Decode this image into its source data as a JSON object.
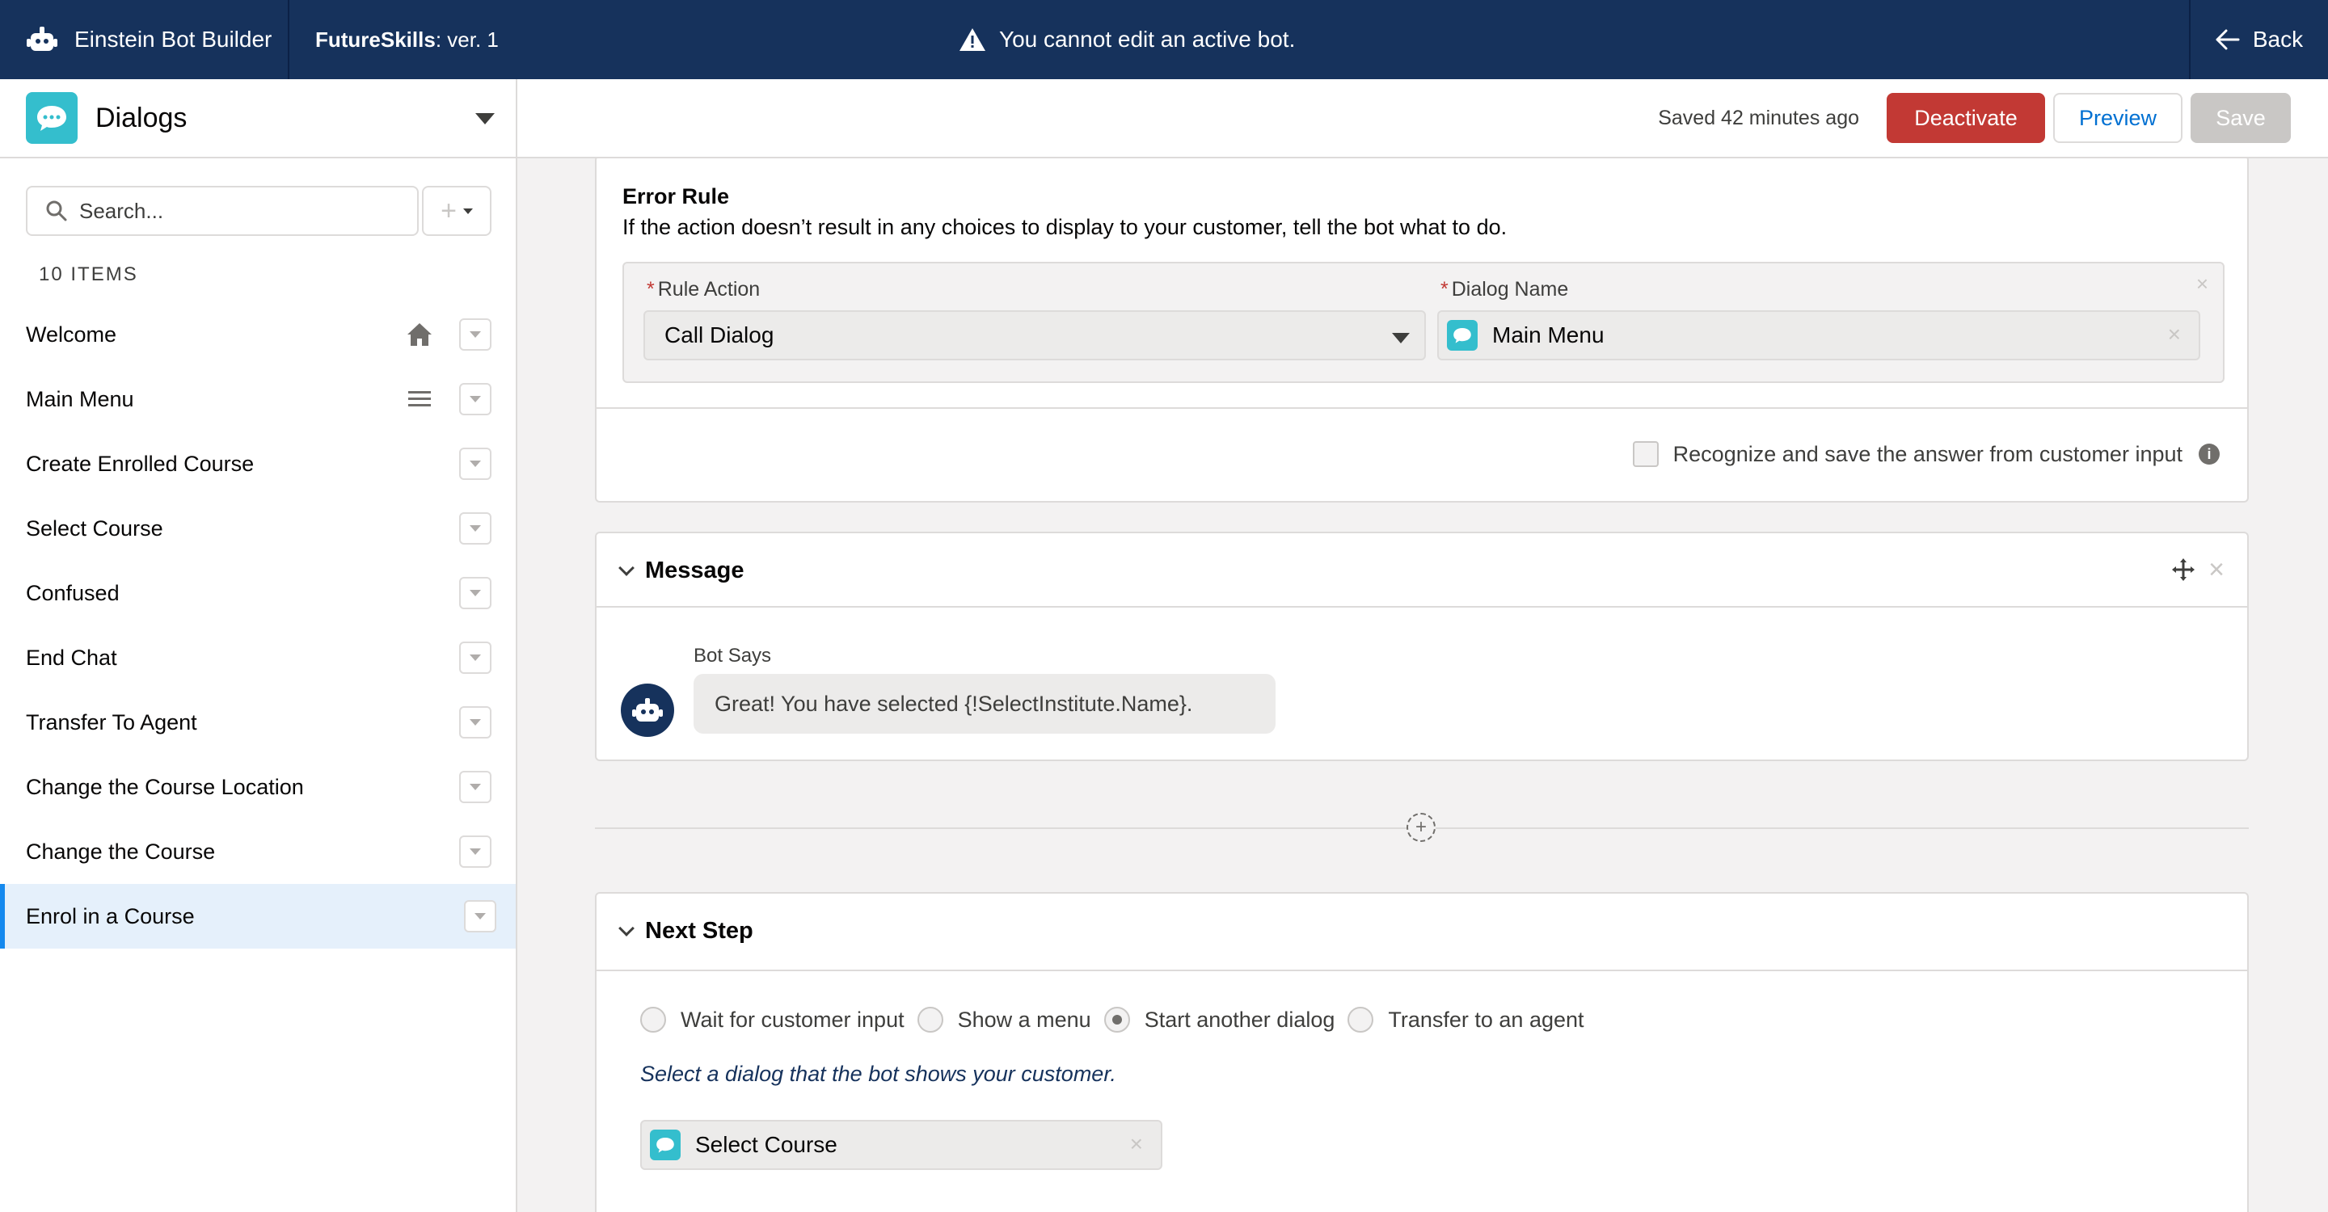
{
  "topbar": {
    "app_title": "Einstein Bot Builder",
    "bot_name": "FutureSkills",
    "bot_version": " : ver. 1",
    "warning": "You cannot edit an active bot.",
    "back_label": "Back"
  },
  "subbar": {
    "section_title": "Dialogs",
    "saved_status": "Saved 42 minutes ago",
    "deactivate_label": "Deactivate",
    "preview_label": "Preview",
    "save_label": "Save"
  },
  "sidebar": {
    "search_placeholder": "Search...",
    "items_count": "10 ITEMS",
    "items": [
      {
        "label": "Welcome",
        "icon": "home-icon"
      },
      {
        "label": "Main Menu",
        "icon": "menu-icon"
      },
      {
        "label": "Create Enrolled Course"
      },
      {
        "label": "Select Course"
      },
      {
        "label": "Confused"
      },
      {
        "label": "End Chat"
      },
      {
        "label": "Transfer To Agent"
      },
      {
        "label": "Change the Course Location"
      },
      {
        "label": "Change the Course"
      },
      {
        "label": "Enrol in a Course",
        "selected": true
      }
    ]
  },
  "error_rule": {
    "title": "Error Rule",
    "description": "If the action doesn’t result in any choices to display to your customer, tell the bot what to do.",
    "rule_action_label": "Rule Action",
    "rule_action_value": "Call Dialog",
    "dialog_name_label": "Dialog Name",
    "dialog_name_value": "Main Menu",
    "recognize_label": "Recognize and save the answer from customer input"
  },
  "message": {
    "title": "Message",
    "bot_says_label": "Bot Says",
    "bot_says_text": "Great! You have selected {!SelectInstitute.Name}."
  },
  "next_step": {
    "title": "Next Step",
    "options": [
      "Wait for customer input",
      "Show a menu",
      "Start another dialog",
      "Transfer to an agent"
    ],
    "selected_option": "Start another dialog",
    "hint": "Select a dialog that the bot shows your customer.",
    "dialog_value": "Select Course"
  },
  "colors": {
    "header": "#16325c",
    "deactivate": "#c23934",
    "dialog_icon": "#34becd",
    "selected_row": "#e5f0fb"
  }
}
